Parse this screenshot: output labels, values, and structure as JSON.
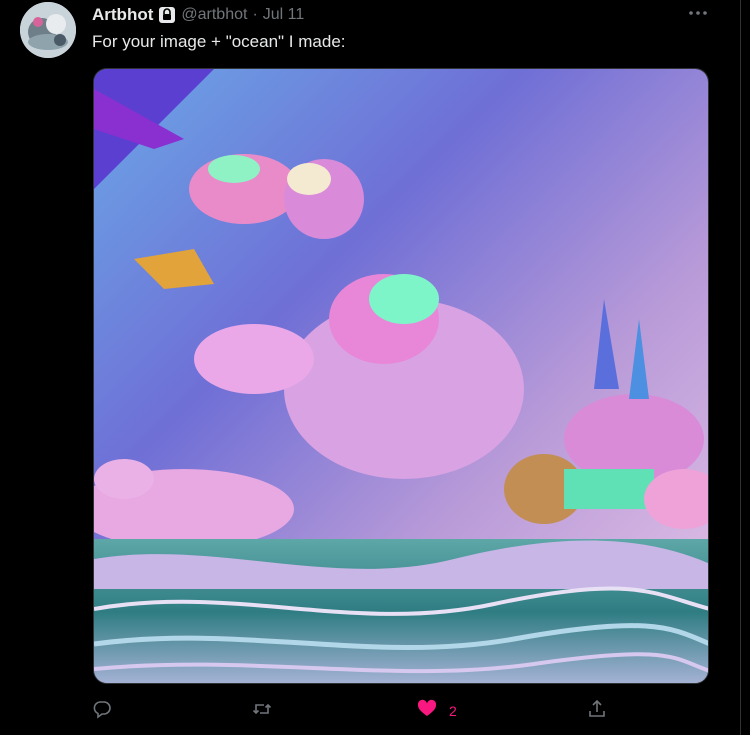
{
  "tweet": {
    "display_name": "Artbhot",
    "handle": "@artbhot",
    "separator": "·",
    "time": "Jul 11",
    "text": "For your image + \"ocean\" I made:",
    "icons": {
      "verified": "lock-icon",
      "more": "more-icon",
      "reply": "reply-icon",
      "retweet": "retweet-icon",
      "like": "heart-icon",
      "share": "share-icon"
    },
    "actions": {
      "like_count": "2"
    },
    "colors": {
      "background": "#000000",
      "text": "#e7e9ea",
      "muted": "#71767b",
      "like": "#f91880"
    }
  }
}
